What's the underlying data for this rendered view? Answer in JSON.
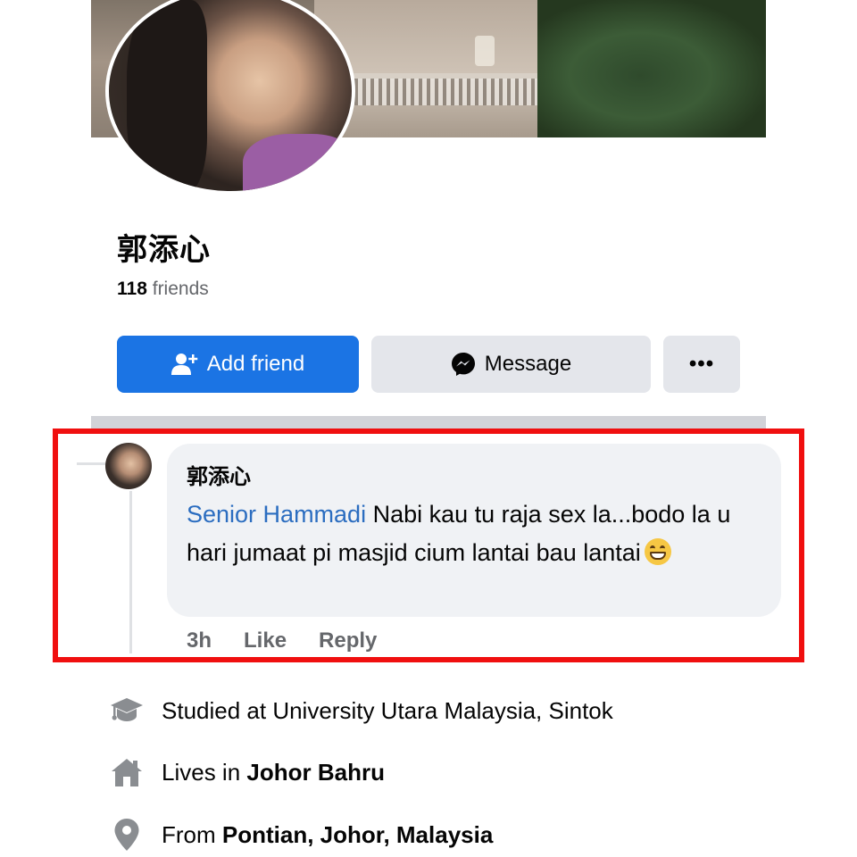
{
  "profile": {
    "name": "郭添心",
    "friends_count": "118",
    "friends_label": "friends"
  },
  "actions": {
    "add_friend": "Add friend",
    "message": "Message",
    "more": "•••"
  },
  "comment": {
    "author": "郭添心",
    "mention": "Senior Hammadi",
    "text": "Nabi kau tu raja sex la...bodo la u hari jumaat pi masjid cium lantai bau lantai",
    "time": "3h",
    "like": "Like",
    "reply": "Reply"
  },
  "details": [
    {
      "icon": "graduation-cap-icon",
      "prefix": "Studied at University Utara Malaysia, Sintok",
      "bold": ""
    },
    {
      "icon": "house-icon",
      "prefix": "Lives in ",
      "bold": "Johor Bahru"
    },
    {
      "icon": "location-pin-icon",
      "prefix": "From ",
      "bold": "Pontian, Johor, Malaysia"
    }
  ],
  "colors": {
    "primary": "#1b74e4",
    "secondary_button": "#e4e6eb",
    "highlight_border": "#f00f0f",
    "mention": "#2b6dc0",
    "muted_text": "#65676b"
  }
}
